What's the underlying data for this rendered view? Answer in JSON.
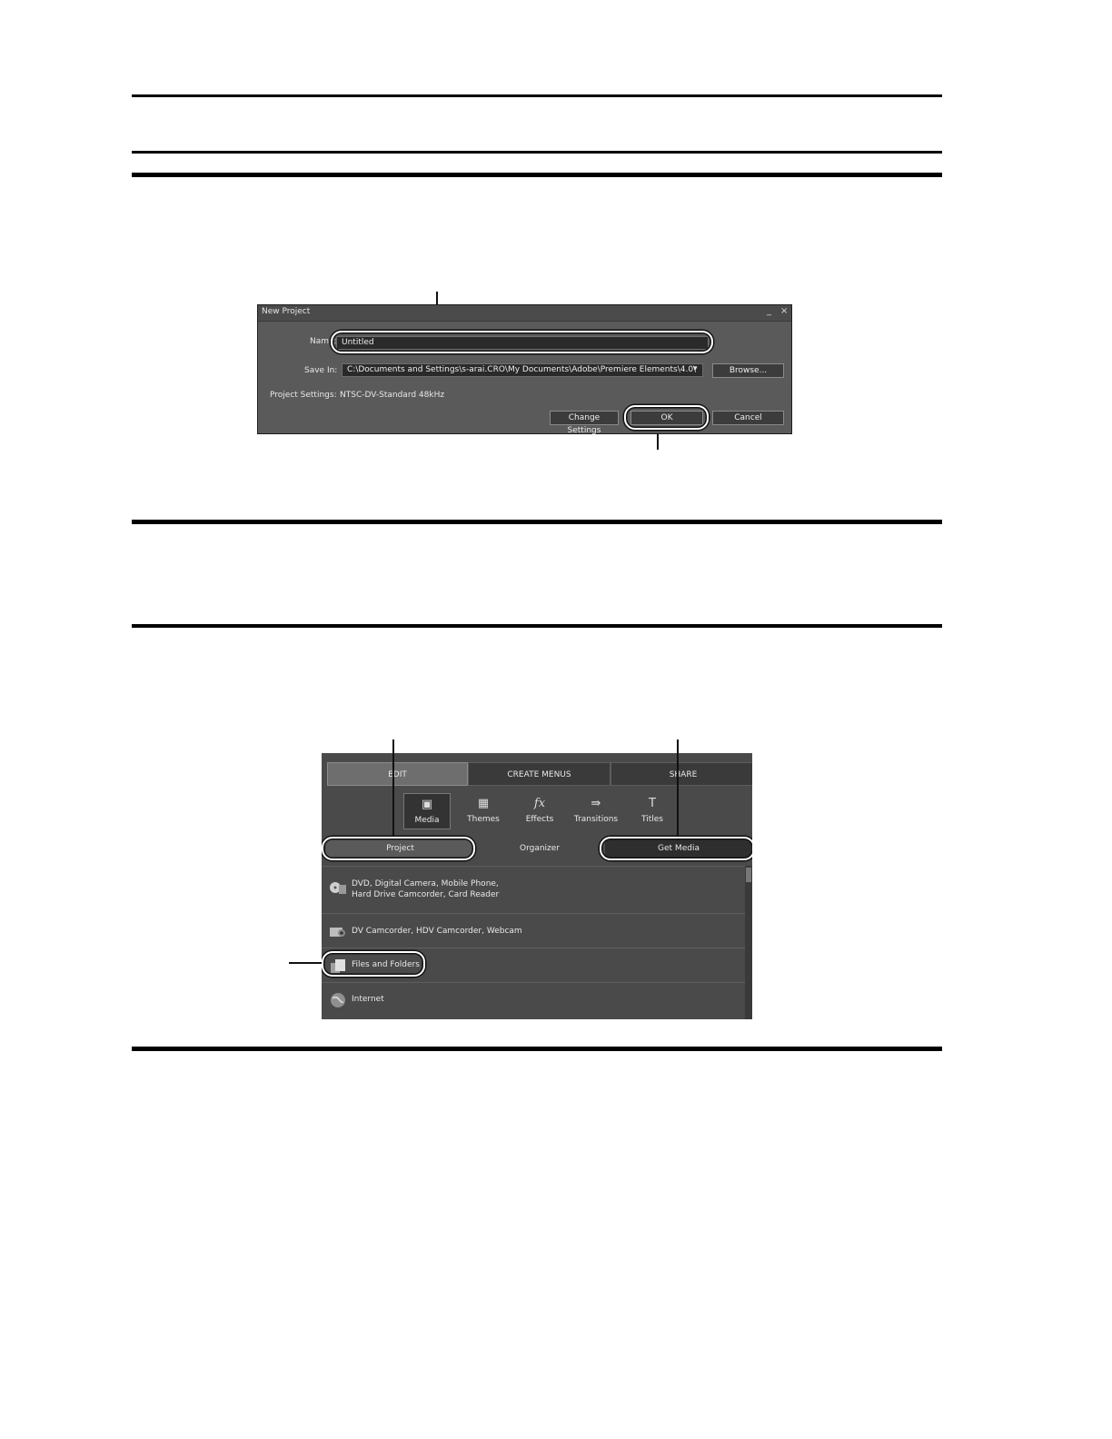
{
  "dialog": {
    "title": "New Project",
    "minimize_glyph": "_",
    "close_glyph": "×",
    "name_label": "Name:",
    "name_value": "Untitled",
    "save_in_label": "Save In:",
    "save_in_value": "C:\\Documents and Settings\\s-arai.CRO\\My Documents\\Adobe\\Premiere Elements\\4.0\\",
    "dropdown_glyph": "▾",
    "browse_label": "Browse...",
    "project_settings_label": "Project Settings:",
    "project_settings_value": "NTSC-DV-Standard 48kHz",
    "change_settings_label": "Change Settings",
    "ok_label": "OK",
    "cancel_label": "Cancel"
  },
  "panel": {
    "tabs": [
      "EDIT",
      "CREATE MENUS",
      "SHARE"
    ],
    "tools": [
      {
        "icon": "media-icon",
        "glyph": "▣",
        "label": "Media"
      },
      {
        "icon": "themes-icon",
        "glyph": "▦",
        "label": "Themes"
      },
      {
        "icon": "effects-icon",
        "glyph": "fx",
        "label": "Effects"
      },
      {
        "icon": "transitions-icon",
        "glyph": "⇛",
        "label": "Transitions"
      },
      {
        "icon": "titles-icon",
        "glyph": "T",
        "label": "Titles"
      }
    ],
    "subtabs": [
      "Project",
      "Organizer",
      "Get Media"
    ],
    "sources": [
      {
        "line1": "DVD, Digital Camera, Mobile Phone,",
        "line2": "Hard Drive Camcorder, Card Reader"
      },
      {
        "line1": "DV Camcorder, HDV Camcorder, Webcam",
        "line2": ""
      },
      {
        "line1": "Files and Folders",
        "line2": ""
      },
      {
        "line1": "Internet",
        "line2": ""
      }
    ]
  }
}
